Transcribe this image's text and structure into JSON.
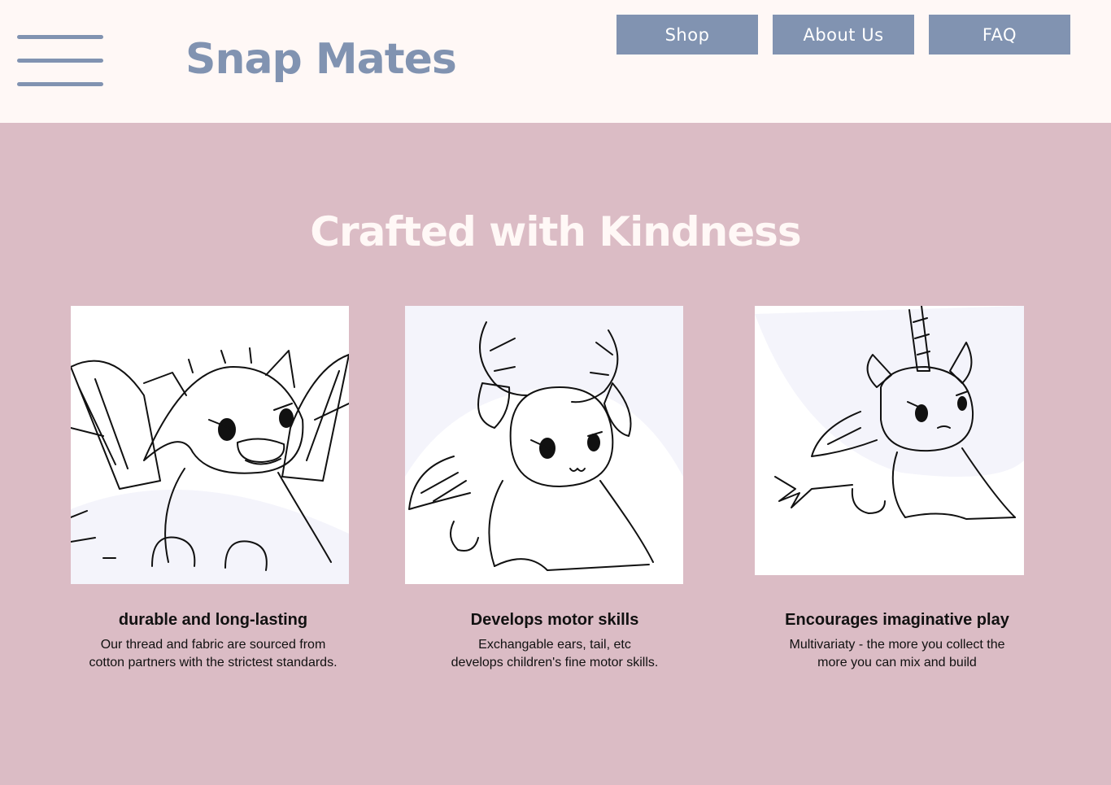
{
  "header": {
    "menu_icon": "hamburger-menu-icon",
    "logo": "Snap Mates",
    "nav": [
      "Shop",
      "About Us",
      "FAQ"
    ]
  },
  "main": {
    "headline": "Crafted with Kindness",
    "features": [
      {
        "image_icon": "winged-dragon-plush-illustration",
        "title": "durable and long-lasting",
        "description_lines": [
          "Our thread and fabric are sourced from",
          "cotton partners with the strictest standards."
        ]
      },
      {
        "image_icon": "antlered-bunny-plush-illustration",
        "title": "Develops motor skills",
        "description_lines": [
          "Exchangable ears, tail, etc",
          "develops children's fine motor skills."
        ]
      },
      {
        "image_icon": "unicorn-plush-illustration",
        "title": "Encourages imaginative play",
        "description_lines": [
          "Multivariaty - the more you collect the",
          "more you can mix and build"
        ]
      }
    ]
  },
  "colors": {
    "header_bg": "#fff8f6",
    "page_bg": "#dbbcc5",
    "accent": "#8193b1",
    "headline": "#fff8f6",
    "text": "#111111"
  }
}
